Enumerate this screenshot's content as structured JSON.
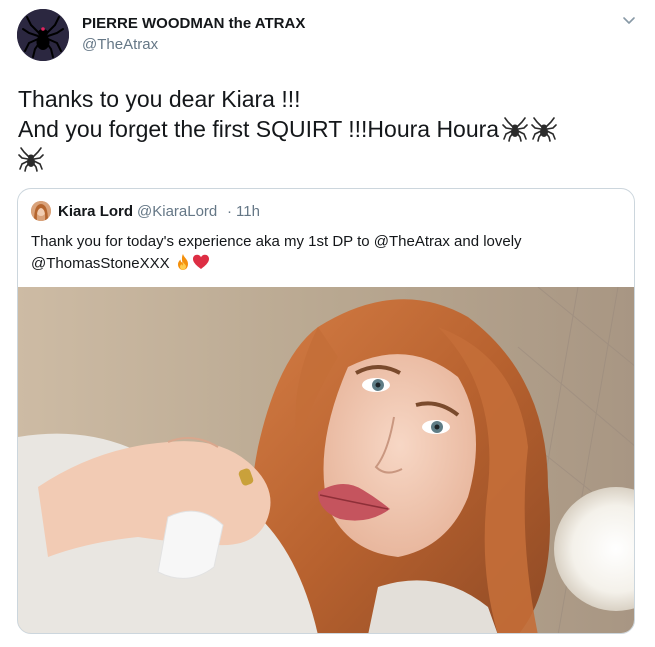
{
  "author": {
    "name": "PIERRE WOODMAN the ATRAX",
    "handle": "@TheAtrax"
  },
  "tweet": {
    "line1": "Thanks to you dear Kiara !!!",
    "line2": "And you forget the first SQUIRT !!!Houra Houra"
  },
  "quoted": {
    "name": "Kiara Lord",
    "handle": "@KiaraLord",
    "separator": "·",
    "time": "11h",
    "line1": "Thank you for today's experience aka my 1st DP to @TheAtrax and lovely",
    "line2": "@ThomasStoneXXX"
  },
  "icons": {
    "caret": "chevron-down-icon",
    "spider": "spider-emoji",
    "fire": "fire-emoji",
    "heart": "red-heart-emoji"
  },
  "colors": {
    "text": "#14171a",
    "secondary": "#657786",
    "border": "#ccd6dd",
    "heart": "#e0245e"
  }
}
